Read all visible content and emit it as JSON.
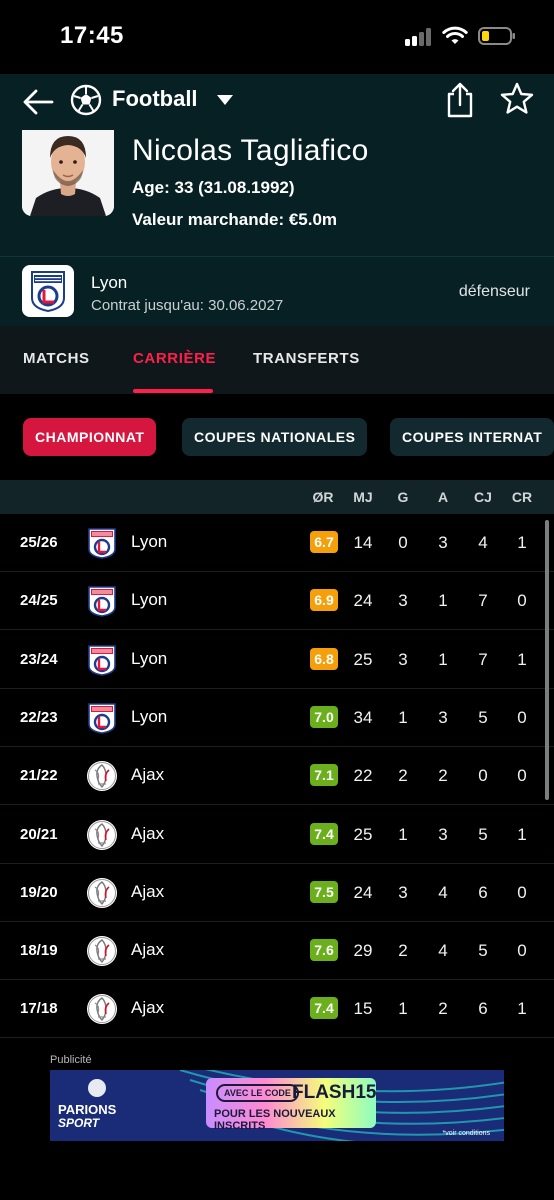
{
  "status_bar": {
    "time": "17:45"
  },
  "header": {
    "sport": "Football"
  },
  "player": {
    "name": "Nicolas Tagliafico",
    "age": "Age: 33 (31.08.1992)",
    "market_value": "Valeur marchande: €5.0m"
  },
  "club": {
    "name": "Lyon",
    "contract": "Contrat jusqu'au: 30.06.2027",
    "position": "défenseur"
  },
  "tabs": [
    "MATCHS",
    "CARRIÈRE",
    "TRANSFERTS"
  ],
  "active_tab": "CARRIÈRE",
  "filters": [
    "CHAMPIONNAT",
    "COUPES NATIONALES",
    "COUPES INTERNAT"
  ],
  "active_filter": "CHAMPIONNAT",
  "table": {
    "headers": [
      "ØR",
      "MJ",
      "G",
      "A",
      "CJ",
      "CR"
    ],
    "rows": [
      {
        "season": "25/26",
        "team": "Lyon",
        "logo": "lyon-logo",
        "rating": "6.7",
        "rating_color": "#f5a00b",
        "mj": "14",
        "g": "0",
        "a": "3",
        "cj": "4",
        "cr": "1"
      },
      {
        "season": "24/25",
        "team": "Lyon",
        "logo": "lyon-logo",
        "rating": "6.9",
        "rating_color": "#f5a00b",
        "mj": "24",
        "g": "3",
        "a": "1",
        "cj": "7",
        "cr": "0"
      },
      {
        "season": "23/24",
        "team": "Lyon",
        "logo": "lyon-logo",
        "rating": "6.8",
        "rating_color": "#f5a00b",
        "mj": "25",
        "g": "3",
        "a": "1",
        "cj": "7",
        "cr": "1"
      },
      {
        "season": "22/23",
        "team": "Lyon",
        "logo": "lyon-logo",
        "rating": "7.0",
        "rating_color": "#6bb01c",
        "mj": "34",
        "g": "1",
        "a": "3",
        "cj": "5",
        "cr": "0"
      },
      {
        "season": "21/22",
        "team": "Ajax",
        "logo": "ajax-logo",
        "rating": "7.1",
        "rating_color": "#6bb01c",
        "mj": "22",
        "g": "2",
        "a": "2",
        "cj": "0",
        "cr": "0"
      },
      {
        "season": "20/21",
        "team": "Ajax",
        "logo": "ajax-logo",
        "rating": "7.4",
        "rating_color": "#6bb01c",
        "mj": "25",
        "g": "1",
        "a": "3",
        "cj": "5",
        "cr": "1"
      },
      {
        "season": "19/20",
        "team": "Ajax",
        "logo": "ajax-logo",
        "rating": "7.5",
        "rating_color": "#6bb01c",
        "mj": "24",
        "g": "3",
        "a": "4",
        "cj": "6",
        "cr": "0"
      },
      {
        "season": "18/19",
        "team": "Ajax",
        "logo": "ajax-logo",
        "rating": "7.6",
        "rating_color": "#6bb01c",
        "mj": "29",
        "g": "2",
        "a": "4",
        "cj": "5",
        "cr": "0"
      },
      {
        "season": "17/18",
        "team": "Ajax",
        "logo": "ajax-logo",
        "rating": "7.4",
        "rating_color": "#6bb01c",
        "mj": "15",
        "g": "1",
        "a": "2",
        "cj": "6",
        "cr": "1"
      }
    ]
  },
  "ad": {
    "label": "Publicité",
    "brand_line1": "PARIONS",
    "brand_line2": "SPORT",
    "pill": "AVEC LE CODE",
    "code": "FLASH15",
    "tagline": "POUR LES NOUVEAUX INSCRITS",
    "legal": "*voir conditions"
  },
  "colors": {
    "accent": "#ff1f4b",
    "header_bg": "#072024",
    "rating_orange": "#f5a00b",
    "rating_green": "#6bb01c"
  }
}
